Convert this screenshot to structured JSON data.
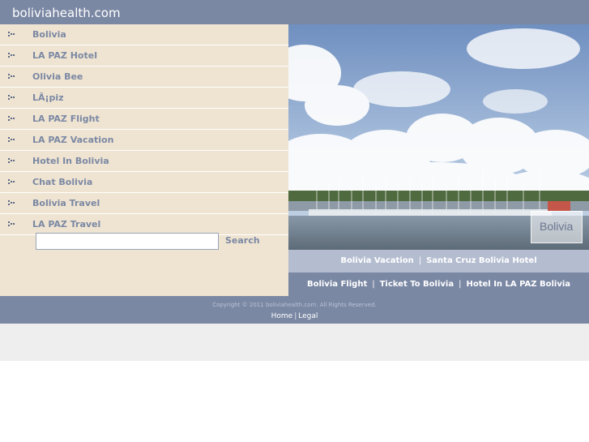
{
  "header": {
    "title": "boliviahealth.com"
  },
  "nav": {
    "items": [
      {
        "label": "Bolivia"
      },
      {
        "label": "LA PAZ Hotel"
      },
      {
        "label": "Olivia Bee"
      },
      {
        "label": "LÃ¡piz"
      },
      {
        "label": "LA PAZ Flight"
      },
      {
        "label": "LA PAZ Vacation"
      },
      {
        "label": "Hotel In Bolivia"
      },
      {
        "label": "Chat Bolivia"
      },
      {
        "label": "Bolivia Travel"
      },
      {
        "label": "LA PAZ Travel"
      }
    ]
  },
  "search": {
    "value": "",
    "button_label": "Search"
  },
  "photo": {
    "caption": "Bolivia"
  },
  "links": {
    "row1": [
      {
        "label": "Bolivia Vacation"
      },
      {
        "label": "Santa Cruz Bolivia Hotel"
      }
    ],
    "row2": [
      {
        "label": "Bolivia Flight"
      },
      {
        "label": "Ticket To Bolivia"
      },
      {
        "label": "Hotel In LA PAZ Bolivia"
      }
    ],
    "separator": "|"
  },
  "footer": {
    "copyright": "Copyright © 2011 boliviahealth.com. All Rights Reserved.",
    "home_label": "Home",
    "pipe": "|",
    "legal_label": "Legal"
  },
  "colors": {
    "header": "#7b88a4",
    "sidebar": "#efe4d1",
    "link_row_light": "#b4bdd0",
    "link_text": "#7b88a4",
    "band": "#eeeeee"
  }
}
